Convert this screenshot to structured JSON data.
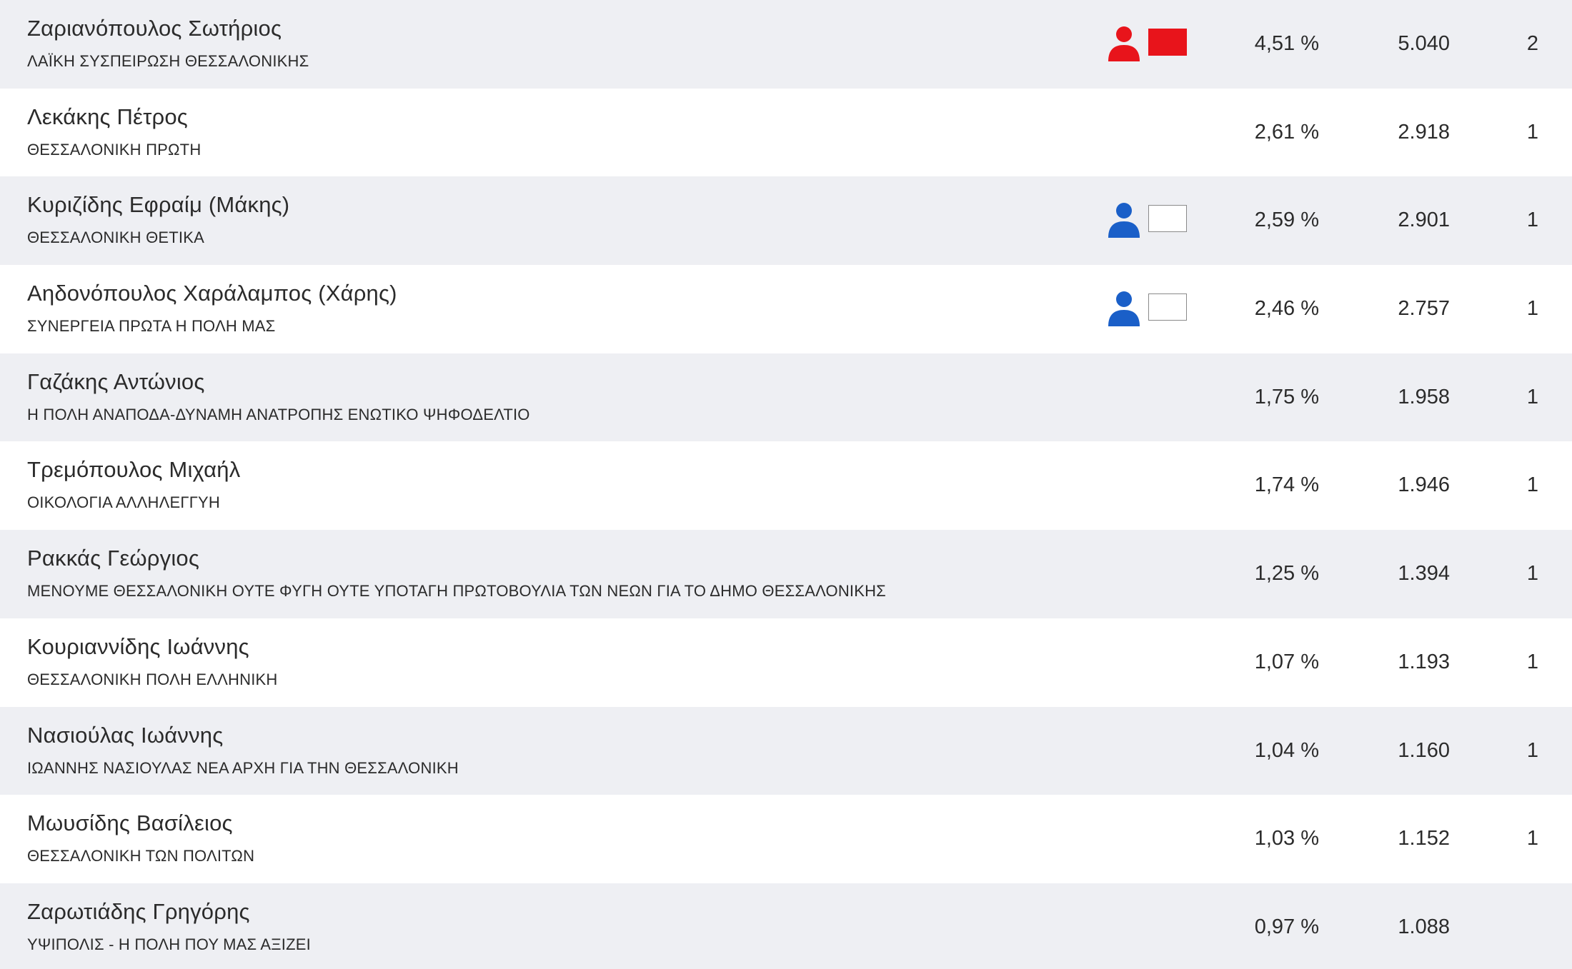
{
  "colors": {
    "row_alt_bg": "#eeeff3",
    "row_plain_bg": "#ffffff",
    "elected_red": "#e8141b",
    "elected_blue": "#1a5fc8"
  },
  "candidates": [
    {
      "name": "Ζαριανόπουλος Σωτήριος",
      "party": "ΛΑΪΚΗ ΣΥΣΠΕΙΡΩΣΗ ΘΕΣΣΑΛΟΝΙΚΗΣ",
      "percent": "4,51 %",
      "votes": "5.040",
      "seats": "2",
      "marker": "red"
    },
    {
      "name": "Λεκάκης Πέτρος",
      "party": "ΘΕΣΣΑΛΟΝΙΚΗ ΠΡΩΤΗ",
      "percent": "2,61 %",
      "votes": "2.918",
      "seats": "1",
      "marker": "none"
    },
    {
      "name": "Κυριζίδης Εφραίμ (Μάκης)",
      "party": "ΘΕΣΣΑΛΟΝΙΚΗ ΘΕΤΙΚΑ",
      "percent": "2,59 %",
      "votes": "2.901",
      "seats": "1",
      "marker": "blue"
    },
    {
      "name": "Αηδονόπουλος Χαράλαμπος (Χάρης)",
      "party": "ΣΥΝΕΡΓΕΙΑ  ΠΡΩΤΑ Η ΠΟΛΗ ΜΑΣ",
      "percent": "2,46 %",
      "votes": "2.757",
      "seats": "1",
      "marker": "blue"
    },
    {
      "name": "Γαζάκης Αντώνιος",
      "party": "Η ΠΟΛΗ ΑΝΑΠΟΔΑ-ΔΥΝΑΜΗ ΑΝΑΤΡΟΠΗΣ ΕΝΩΤΙΚΟ ΨΗΦΟΔΕΛΤΙΟ",
      "percent": "1,75 %",
      "votes": "1.958",
      "seats": "1",
      "marker": "none"
    },
    {
      "name": "Τρεμόπουλος Μιχαήλ",
      "party": "ΟΙΚΟΛΟΓΙΑ ΑΛΛΗΛΕΓΓΥΗ",
      "percent": "1,74 %",
      "votes": "1.946",
      "seats": "1",
      "marker": "none"
    },
    {
      "name": "Ρακκάς Γεώργιος",
      "party": "ΜΕΝΟΥΜΕ ΘΕΣΣΑΛΟΝΙΚΗ ΟΥΤΕ ΦΥΓΗ ΟΥΤΕ ΥΠΟΤΑΓΗ ΠΡΩΤΟΒΟΥΛΙΑ ΤΩΝ ΝΕΩΝ ΓΙΑ ΤΟ ΔΗΜΟ ΘΕΣΣΑΛΟΝΙΚΗΣ",
      "percent": "1,25 %",
      "votes": "1.394",
      "seats": "1",
      "marker": "none"
    },
    {
      "name": "Κουριαννίδης Ιωάννης",
      "party": "ΘΕΣΣΑΛΟΝΙΚΗ ΠΟΛΗ ΕΛΛΗΝΙΚΗ",
      "percent": "1,07 %",
      "votes": "1.193",
      "seats": "1",
      "marker": "none"
    },
    {
      "name": "Νασιούλας Ιωάννης",
      "party": "ΙΩΑΝΝΗΣ ΝΑΣΙΟΥΛΑΣ  ΝΕΑ ΑΡΧΗ ΓΙΑ ΤΗΝ ΘΕΣΣΑΛΟΝΙΚΗ",
      "percent": "1,04 %",
      "votes": "1.160",
      "seats": "1",
      "marker": "none"
    },
    {
      "name": "Μωυσίδης Βασίλειος",
      "party": "ΘΕΣΣΑΛΟΝΙΚΗ ΤΩΝ ΠΟΛΙΤΩΝ",
      "percent": "1,03 %",
      "votes": "1.152",
      "seats": "1",
      "marker": "none"
    },
    {
      "name": "Ζαρωτιάδης Γρηγόρης",
      "party": "ΥΨΙΠΟΛΙΣ - Η ΠΟΛΗ ΠΟΥ ΜΑΣ ΑΞΙΖΕΙ",
      "percent": "0,97 %",
      "votes": "1.088",
      "seats": "",
      "marker": "none"
    }
  ]
}
